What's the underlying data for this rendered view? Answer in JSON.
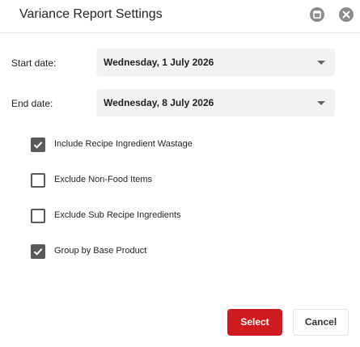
{
  "dialog": {
    "title": "Variance Report Settings"
  },
  "fields": {
    "start_date": {
      "label": "Start date:",
      "value": "Wednesday, 1 July 2026"
    },
    "end_date": {
      "label": "End date:",
      "value": "Wednesday, 8 July 2026"
    }
  },
  "options": [
    {
      "label": "Include Recipe Ingredient Wastage",
      "checked": true
    },
    {
      "label": "Exclude Non-Food Items",
      "checked": false
    },
    {
      "label": "Exclude Sub Recipe Ingredients",
      "checked": false
    },
    {
      "label": "Group by Base Product",
      "checked": true
    }
  ],
  "buttons": {
    "select": "Select",
    "cancel": "Cancel"
  },
  "colors": {
    "primary": "#cf1a1f",
    "checkbox": "#5a5a5a",
    "header_icon": "#8c8c8c"
  },
  "icons": {
    "minimize": "minimize-icon",
    "close": "close-icon",
    "dropdown": "chevron-down-icon",
    "check": "checkmark-icon"
  }
}
